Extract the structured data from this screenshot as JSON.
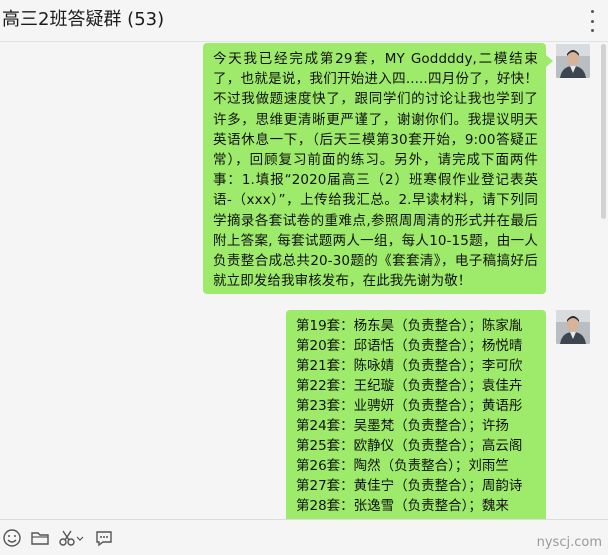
{
  "header": {
    "title": "高三2班答疑群 (53)",
    "more_icon": "more-vertical-icon"
  },
  "messages": [
    {
      "sender_avatar": "user-avatar",
      "text": "今天我已经完成第29套，MY Goddddy,二模结束了，也就是说，我们开始进入四.....四月份了，好快！不过我做题速度快了，跟同学们的讨论让我也学到了许多，思维更清晰更严谨了，谢谢你们。我提议明天英语休息一下，（后天三模第30套开始，9:00答疑正常），回顾复习前面的练习。另外，请完成下面两件事：1.填报“2020届高三（2）班寒假作业登记表英语-（xxx）”，上传给我汇总。2.早读材料，请下列同学摘录各套试卷的重难点,参照周周清的形式并在最后附上答案, 每套试题两人一组，每人10-15题，由一人负责整合成总共20-30题的《套套清》，电子稿搞好后就立即发给我审核发布，在此我先谢为敬！"
    },
    {
      "sender_avatar": "user-avatar",
      "lines": [
        "第19套：杨东昊（负责整合）；陈家胤",
        "第20套：邱语恬（负责整合）；杨悦晴",
        "第21套：陈咏婧（负责整合）；李可欣",
        "第22套：王纪璇（负责整合）；袁佳卉",
        "第23套：业骋妍（负责整合）；黄语彤",
        "第24套：吴墨梵（负责整合）；许扬",
        "第25套：欧静仪（负责整合）；高云阁",
        "第26套：陶然（负责整合）；刘雨竺",
        "第27套：黄佳宁（负责整合）；周韵诗",
        "第28套：张逸雪（负责整合）；魏来"
      ]
    }
  ],
  "toolbar": {
    "icons": [
      "emoji-icon",
      "folder-icon",
      "scissors-icon",
      "chat-history-icon"
    ]
  },
  "watermark": "nyscj.com",
  "colors": {
    "bubble": "#9eea6a",
    "background": "#f5f5f5",
    "header_text": "#1b1b1b"
  }
}
